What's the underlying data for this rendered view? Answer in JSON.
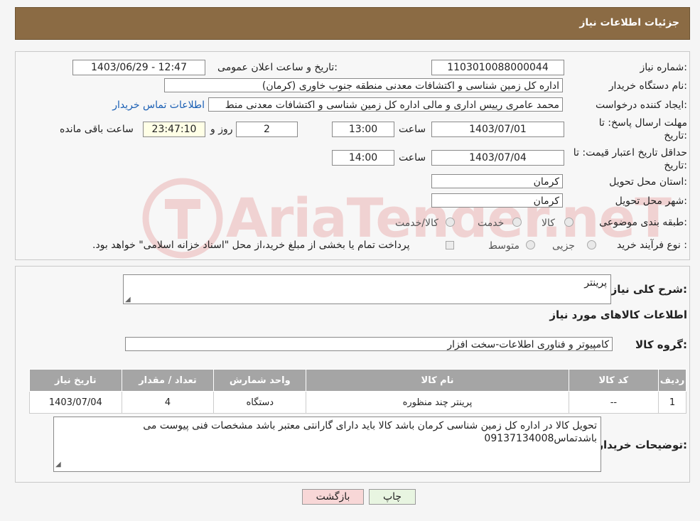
{
  "header": {
    "title": "جزئیات اطلاعات نیاز"
  },
  "watermark": "AriaTender.neT",
  "form": {
    "need_number_label": "شماره نیاز:",
    "need_number": "1103010088000044",
    "announce_label": "تاریخ و ساعت اعلان عمومی:",
    "announce_value": "1403/06/29 - 12:47",
    "buyer_label": "نام دستگاه خریدار:",
    "buyer_value": "اداره کل زمین شناسی و اکتشافات معدنی منطقه جنوب خاوری (کرمان)",
    "creator_label": "ایجاد کننده درخواست:",
    "creator_value": "محمد  عامری رییس اداری و مالی اداره کل زمین شناسی و اکتشافات معدنی منط",
    "contact_link": "اطلاعات تماس خریدار",
    "deadline_label_1": "مهلت ارسال پاسخ: تا",
    "deadline_label_2": "تاریخ:",
    "deadline_date": "1403/07/01",
    "time_label": "ساعت",
    "deadline_time": "13:00",
    "days_value": "2",
    "days_label": "روز و",
    "remaining_time": "23:47:10",
    "remaining_label": "ساعت باقی مانده",
    "validity_label_1": "حداقل تاریخ اعتبار قیمت: تا",
    "validity_label_2": "تاریخ:",
    "validity_date": "1403/07/04",
    "validity_time_label": "ساعت",
    "validity_time": "14:00",
    "province_label": "استان محل تحویل:",
    "province_value": "کرمان",
    "city_label": "شهر محل تحویل:",
    "city_value": "کرمان",
    "category_label": "طبقه بندی موضوعی:",
    "category_options": [
      "کالا",
      "خدمت",
      "کالا/خدمت"
    ],
    "process_label": "نوع فرآیند خرید :",
    "process_options": [
      "جزیی",
      "متوسط"
    ],
    "payment_note": "پرداخت تمام یا بخشی از مبلغ خرید،از محل \"اسناد خزانه اسلامی\" خواهد بود."
  },
  "details": {
    "summary_label": "شرح کلی نیاز:",
    "summary_value": "پرینتر",
    "goods_info_title": "اطلاعات کالاهای مورد نیاز",
    "group_label": "گروه کالا:",
    "group_value": "کامپیوتر و فناوری اطلاعات-سخت افزار",
    "table_headers": [
      "ردیف",
      "کد کالا",
      "نام کالا",
      "واحد شمارش",
      "تعداد / مقدار",
      "تاریخ نیاز"
    ],
    "rows": [
      [
        "1",
        "--",
        "پرینتر چند منظوره",
        "دستگاه",
        "4",
        "1403/07/04"
      ]
    ],
    "buyer_notes_label": "توضیحات خریدار:",
    "buyer_notes": "تحویل کالا در اداره کل زمین شناسی کرمان باشد  کالا باید دارای گارانتی معتبر باشد مشخصات فنی پیوست می باشدتماس09137134008"
  },
  "buttons": {
    "print": "چاپ",
    "back": "بازگشت"
  },
  "colors": {
    "header": "#8b6b44",
    "table_header": "#a5a5a5",
    "link": "#1a5fb4",
    "back_button": "#f8d7d7",
    "print_button": "#e8f5e1"
  }
}
